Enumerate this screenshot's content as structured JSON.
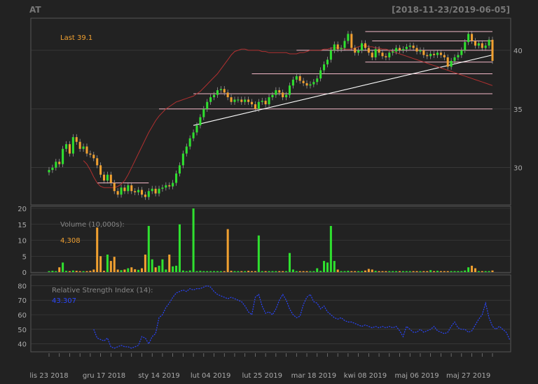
{
  "title": "AT",
  "date_range": "[2018-11-23/2019-06-05]",
  "colors": {
    "background": "#222222",
    "grid": "#444444",
    "up": "#2fe02f",
    "down": "#f0a030",
    "sma": "#b03030",
    "trendline": "#ffffff",
    "hline": "#f4b8c8",
    "rsi": "#2a46ff",
    "last_label": "#f0a030",
    "label": "#888888"
  },
  "chart_data": [
    {
      "type": "candlestick",
      "panel": "price",
      "last_label": "Last 39.1",
      "y_ticks": [
        "30",
        "35",
        "40"
      ],
      "ylim": [
        27,
        42.5
      ],
      "n_bars": 130,
      "closes": [
        29.8,
        30.0,
        30.5,
        30.3,
        31.6,
        32.0,
        31.2,
        32.6,
        32.2,
        31.6,
        31.8,
        31.2,
        31.1,
        30.8,
        30.2,
        29.4,
        28.9,
        29.4,
        28.7,
        28.0,
        27.7,
        28.3,
        28.0,
        28.5,
        28.0,
        27.9,
        28.1,
        27.7,
        27.5,
        28.0,
        28.2,
        27.8,
        28.2,
        28.3,
        28.5,
        28.4,
        28.7,
        29.5,
        30.2,
        31.2,
        31.8,
        32.5,
        33.0,
        33.6,
        34.3,
        35.0,
        35.6,
        36.0,
        36.2,
        36.6,
        36.7,
        36.4,
        36.0,
        35.6,
        35.8,
        35.8,
        35.6,
        35.8,
        35.6,
        35.4,
        35.0,
        35.6,
        35.7,
        35.4,
        36.0,
        36.2,
        36.6,
        36.4,
        36.0,
        36.2,
        37.0,
        37.5,
        37.8,
        37.4,
        37.2,
        37.0,
        37.1,
        37.3,
        37.6,
        38.3,
        38.8,
        39.2,
        40.0,
        40.5,
        40.1,
        40.2,
        40.8,
        41.4,
        40.2,
        39.8,
        40.0,
        40.6,
        40.2,
        39.8,
        39.4,
        40.1,
        39.8,
        39.5,
        39.4,
        39.8,
        39.9,
        40.2,
        40.0,
        40.1,
        40.3,
        40.4,
        40.2,
        39.9,
        40.0,
        39.6,
        39.5,
        39.7,
        39.6,
        39.8,
        39.6,
        39.4,
        38.6,
        39.1,
        39.4,
        39.6,
        40.0,
        40.7,
        41.4,
        40.8,
        40.4,
        40.6,
        40.2,
        40.4,
        40.9,
        39.1
      ],
      "sma": {
        "color": "#b03030",
        "start_index": 10,
        "values": [
          30.6,
          30.3,
          29.8,
          29.2,
          28.7,
          28.4,
          28.3,
          28.3,
          28.3,
          28.3,
          28.4,
          28.6,
          28.9,
          29.4,
          30.0,
          30.6,
          31.2,
          31.8,
          32.4,
          33.0,
          33.5,
          34.0,
          34.4,
          34.7,
          35.0,
          35.2,
          35.4,
          35.6,
          35.7,
          35.8,
          35.9,
          36.0,
          36.1,
          36.3,
          36.5,
          36.8,
          37.1,
          37.4,
          37.7,
          38.0,
          38.4,
          38.8,
          39.2,
          39.6,
          39.9,
          40.0,
          40.1,
          40.1,
          40.0,
          40.0,
          40.0,
          40.0,
          39.9,
          39.9,
          39.8,
          39.8,
          39.8,
          39.8,
          39.8,
          39.8,
          39.7,
          39.7,
          39.7,
          39.8,
          39.8,
          39.9,
          40.0,
          40.0,
          40.0,
          40.0,
          40.1,
          40.1,
          40.2,
          40.2,
          40.2,
          40.2,
          40.1,
          40.1,
          40.1,
          40.2,
          40.3,
          40.4,
          40.4,
          40.3,
          40.3,
          40.2,
          40.2,
          40.1,
          40.1,
          40.0,
          39.9,
          39.8,
          39.7,
          39.6,
          39.5,
          39.4,
          39.3,
          39.2,
          39.1,
          39.0,
          38.9,
          38.8,
          38.7,
          38.6,
          38.5,
          38.4,
          38.3,
          38.2,
          38.1,
          38.0,
          37.9,
          37.8,
          37.7,
          37.6,
          37.5,
          37.4,
          37.3,
          37.2,
          37.1,
          37.0
        ]
      },
      "trendlines": [
        {
          "x": [
            42,
            129
          ],
          "y": [
            33.6,
            39.6
          ]
        }
      ],
      "hlines": [
        {
          "x": [
            14,
            29
          ],
          "y": 28.7
        },
        {
          "x": [
            32,
            129
          ],
          "y": 35.0
        },
        {
          "x": [
            42,
            129
          ],
          "y": 36.3
        },
        {
          "x": [
            59,
            129
          ],
          "y": 38.0
        },
        {
          "x": [
            72,
            129
          ],
          "y": 40.0
        },
        {
          "x": [
            92,
            129
          ],
          "y": 39.0
        },
        {
          "x": [
            94,
            129
          ],
          "y": 40.8
        },
        {
          "x": [
            92,
            129
          ],
          "y": 41.6
        }
      ]
    },
    {
      "type": "bar",
      "panel": "volume",
      "label": "Volume (10,000s):",
      "last_value": "4,308",
      "y_ticks": [
        "0",
        "5",
        "10",
        "15",
        "20"
      ],
      "ylim": [
        0,
        20
      ],
      "values": [
        0.3,
        0.4,
        0.3,
        1.5,
        3.0,
        0.4,
        0.3,
        0.5,
        0.4,
        0.3,
        0.3,
        0.3,
        0.4,
        0.8,
        14.0,
        5.0,
        0.4,
        5.5,
        3.5,
        4.8,
        0.8,
        0.6,
        0.8,
        1.2,
        1.5,
        0.9,
        0.7,
        1.2,
        5.5,
        14.5,
        4.0,
        1.5,
        2.0,
        4.0,
        0.8,
        5.5,
        1.8,
        2.0,
        15.0,
        0.5,
        0.3,
        0.5,
        20.0,
        0.3,
        0.4,
        0.3,
        0.3,
        0.3,
        0.3,
        0.3,
        0.3,
        0.3,
        13.5,
        0.4,
        0.3,
        0.3,
        0.3,
        0.3,
        0.4,
        0.3,
        0.3,
        11.5,
        0.3,
        0.3,
        0.3,
        0.3,
        0.3,
        0.3,
        0.3,
        0.3,
        6.0,
        0.8,
        0.3,
        0.3,
        0.3,
        0.3,
        0.3,
        0.3,
        1.2,
        0.4,
        3.5,
        3.0,
        14.5,
        3.5,
        0.8,
        0.3,
        0.3,
        0.4,
        0.3,
        0.3,
        0.3,
        0.3,
        0.5,
        1.0,
        0.8,
        0.4,
        0.3,
        0.3,
        0.3,
        0.3,
        0.3,
        0.3,
        0.3,
        0.3,
        0.3,
        0.3,
        0.3,
        0.3,
        0.3,
        0.3,
        0.3,
        0.6,
        0.3,
        0.4,
        0.3,
        0.3,
        0.3,
        0.3,
        0.3,
        0.3,
        0.3,
        0.5,
        1.5,
        2.0,
        1.2,
        0.3,
        0.3,
        0.3,
        0.3,
        0.5
      ]
    },
    {
      "type": "line",
      "panel": "rsi",
      "label": "Relative Strength Index (14):",
      "last_value": "43.307",
      "y_ticks": [
        "40",
        "50",
        "60",
        "70",
        "80"
      ],
      "ylim": [
        35,
        85
      ],
      "start_index": 13,
      "values": [
        50,
        44,
        43,
        42,
        44,
        38,
        37,
        38,
        39,
        38,
        38,
        37,
        38,
        39,
        45,
        44,
        40,
        45,
        47,
        58,
        60,
        65,
        68,
        72,
        75,
        76,
        77,
        76,
        78,
        77,
        78,
        78,
        79,
        80,
        79,
        76,
        74,
        73,
        72,
        71,
        72,
        71,
        70,
        69,
        66,
        62,
        60,
        72,
        74,
        66,
        61,
        62,
        60,
        64,
        70,
        74,
        70,
        64,
        60,
        58,
        59,
        67,
        72,
        74,
        69,
        68,
        64,
        66,
        62,
        60,
        58,
        57,
        58,
        56,
        55,
        55,
        54,
        53,
        52,
        53,
        52,
        51,
        52,
        51,
        52,
        51,
        52,
        51,
        52,
        49,
        45,
        52,
        50,
        48,
        48,
        50,
        48,
        49,
        50,
        52,
        49,
        48,
        47,
        48,
        52,
        55,
        51,
        50,
        50,
        48,
        49,
        53,
        57,
        60,
        68,
        58,
        52,
        50,
        52,
        50,
        48,
        43
      ]
    }
  ],
  "x_axis": {
    "n_bars": 130,
    "labels": [
      {
        "text": "lis 23 2018",
        "index": 0
      },
      {
        "text": "gru 17 2018",
        "index": 16
      },
      {
        "text": "sty 14 2019",
        "index": 32
      },
      {
        "text": "lut 04 2019",
        "index": 47
      },
      {
        "text": "lut 25 2019",
        "index": 62
      },
      {
        "text": "mar 18 2019",
        "index": 77
      },
      {
        "text": "kwi 08 2019",
        "index": 92
      },
      {
        "text": "maj 06 2019",
        "index": 107
      },
      {
        "text": "maj 27 2019",
        "index": 122
      }
    ]
  }
}
